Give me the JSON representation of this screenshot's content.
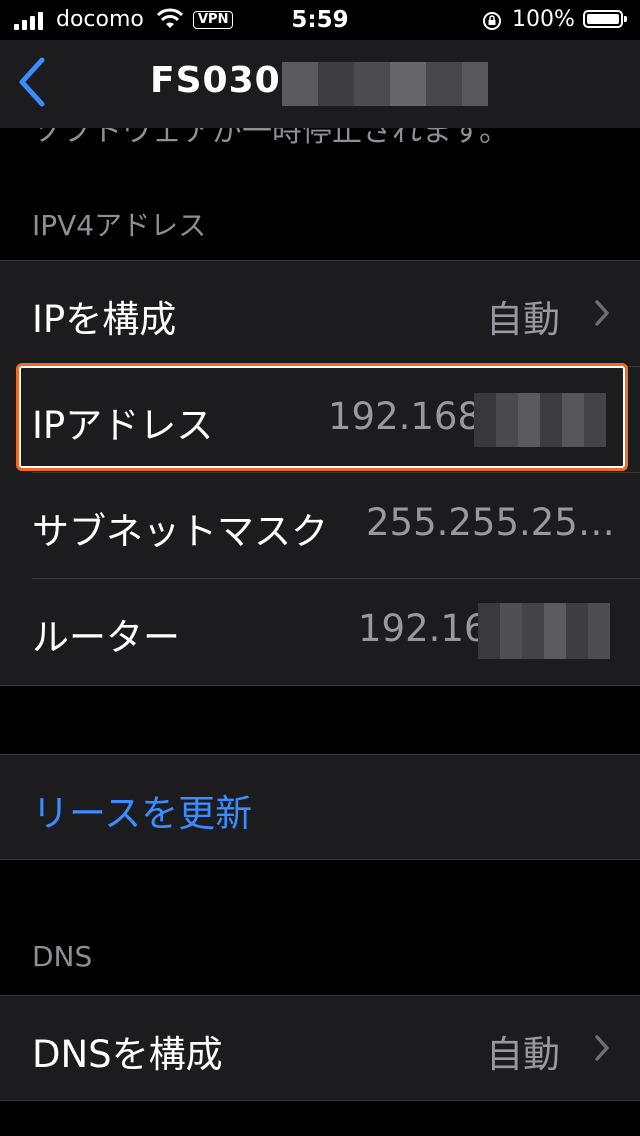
{
  "status_bar": {
    "carrier": "docomo",
    "vpn": "VPN",
    "time": "5:59",
    "battery": "100%"
  },
  "nav": {
    "title": "FS030"
  },
  "scrolled_text": "ソフトウェアが一時停止されます。",
  "ipv4": {
    "header": "IPV4アドレス",
    "rows": [
      {
        "label": "IPを構成",
        "value": "自動"
      },
      {
        "label": "IPアドレス",
        "value": "192.168"
      },
      {
        "label": "サブネットマスク",
        "value": "255.255.25…"
      },
      {
        "label": "ルーター",
        "value": "192.16"
      }
    ]
  },
  "renew": {
    "label": "リースを更新"
  },
  "dns": {
    "header": "DNS",
    "rows": [
      {
        "label": "DNSを構成",
        "value": "自動"
      }
    ]
  },
  "colors": {
    "accent": "#3a8cff",
    "highlight": "#f26b21",
    "secondary_text": "#98989f",
    "cell_bg": "#1c1c1e"
  }
}
